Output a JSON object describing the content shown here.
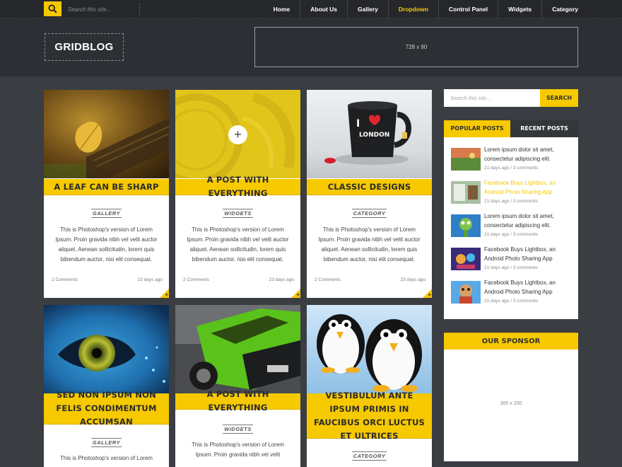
{
  "topbar": {
    "search_placeholder": "Search this site...",
    "nav": [
      "Home",
      "About Us",
      "Gallery",
      "Dropdown",
      "Control Panel",
      "Widgets",
      "Category"
    ],
    "active_nav": "Dropdown"
  },
  "header": {
    "logo": "GRIDBLOG",
    "banner": "728 x 90"
  },
  "posts": [
    {
      "title": "A LEAF CAN BE SHARP",
      "category": "GALLERY",
      "excerpt": "This is Photoshop's version  of Lorem Ipsum. Proin gravida nibh vel velit auctor aliquet. Aenean sollicitudin, lorem quis bibendum auctor, nisi elit consequat.",
      "comments": "2 Comments",
      "date": "23 days ago",
      "image": "leaf"
    },
    {
      "title": "A POST WITH EVERYTHING",
      "category": "WIDGETS",
      "excerpt": "This is Photoshop's version  of Lorem Ipsum. Proin gravida nibh vel velit auctor aliquet. Aenean sollicitudin, lorem quis bibendum auctor, nisi elit consequat.",
      "comments": "2 Comments",
      "date": "23 days ago",
      "image": "gauge"
    },
    {
      "title": "CLASSIC DESIGNS",
      "category": "CATEGORY",
      "excerpt": "This is Photoshop's version  of Lorem Ipsum. Proin gravida nibh vel velit auctor aliquet. Aenean sollicitudin, lorem quis bibendum auctor, nisi elit consequat.",
      "comments": "2 Comments",
      "date": "23 days ago",
      "image": "mug"
    },
    {
      "title": "SED NON IPSUM NON FELIS CONDIMENTUM ACCUMSAN",
      "category": "GALLERY",
      "excerpt": "This is Photoshop's version  of Lorem",
      "image": "eye"
    },
    {
      "title": "A POST WITH EVERYTHING",
      "category": "WIDGETS",
      "excerpt": "This is Photoshop's version  of Lorem Ipsum. Proin gravida nibh vel velit",
      "image": "car"
    },
    {
      "title": "VESTIBULUM ANTE IPSUM PRIMIS IN FAUCIBUS ORCI LUCTUS ET ULTRICES",
      "category": "CATEGORY",
      "image": "penguins"
    }
  ],
  "mug_text": {
    "line1": "I",
    "line2": "LONDON"
  },
  "sidebar": {
    "search_placeholder": "Search this site...",
    "search_button": "SEARCH",
    "tab_popular": "POPULAR POSTS",
    "tab_recent": "RECENT POSTS",
    "popular": [
      {
        "line1": "Lorem ipsum dolor sit amet,",
        "line2": "consectetur adipiscing elit.",
        "meta": "21 days ago / 3 comments",
        "highlight": false
      },
      {
        "line1": "Facebook Buys Lightbox, an",
        "line2": "Android Photo Sharing App",
        "meta": "21 days ago / 3 comments",
        "highlight": true
      },
      {
        "line1": "Lorem ipsum dolor sit amet,",
        "line2": "consectetur adipiscing elit.",
        "meta": "21 days ago / 3 comments",
        "highlight": false
      },
      {
        "line1": "Facebook Buys Lightbox, an",
        "line2": "Android Photo Sharing App",
        "meta": "21 days ago / 3 comments",
        "highlight": false
      },
      {
        "line1": "Facebook Buys Lightbox, an",
        "line2": "Android Photo Sharing App",
        "meta": "21 days ago / 3 comments",
        "highlight": false
      }
    ],
    "sponsor_title": "OUR SPONSOR",
    "sponsor_ad": "300 x 250"
  },
  "colors": {
    "accent": "#f6c900",
    "background": "#3a3d41",
    "topbar": "#25272a"
  }
}
